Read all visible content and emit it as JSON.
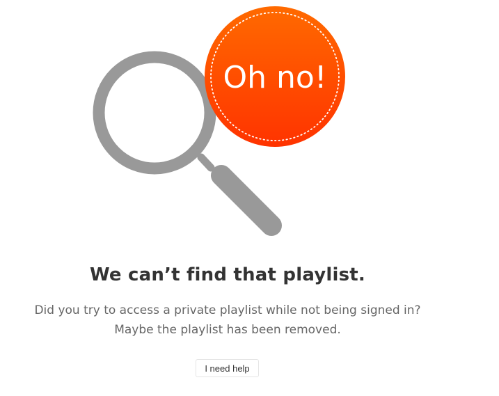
{
  "badge": {
    "text": "Oh no!",
    "color_top": "#ff6a00",
    "color_bottom": "#ff3300"
  },
  "illustration": {
    "icon": "magnifying-glass-icon",
    "color": "#999999"
  },
  "error": {
    "heading": "We can’t find that playlist.",
    "line1": "Did you try to access a private playlist while not being signed in?",
    "line2": "Maybe the playlist has been removed."
  },
  "actions": {
    "help_label": "I need help"
  }
}
